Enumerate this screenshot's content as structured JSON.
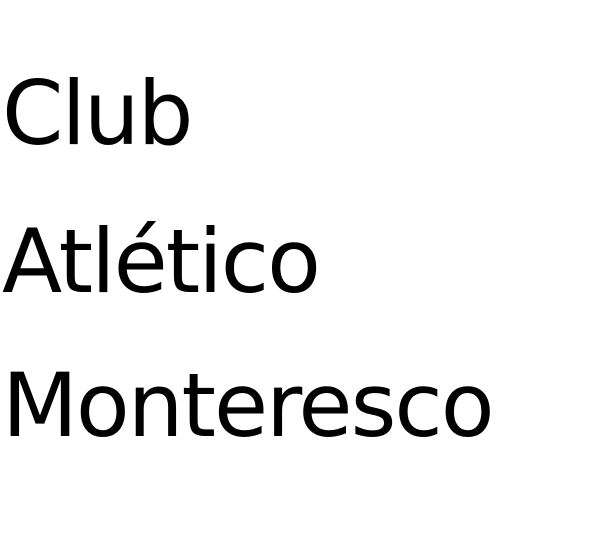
{
  "text": {
    "lines": [
      "Club",
      "Atlético",
      "Monteresco"
    ],
    "color": "#000000",
    "background": "#ffffff"
  }
}
